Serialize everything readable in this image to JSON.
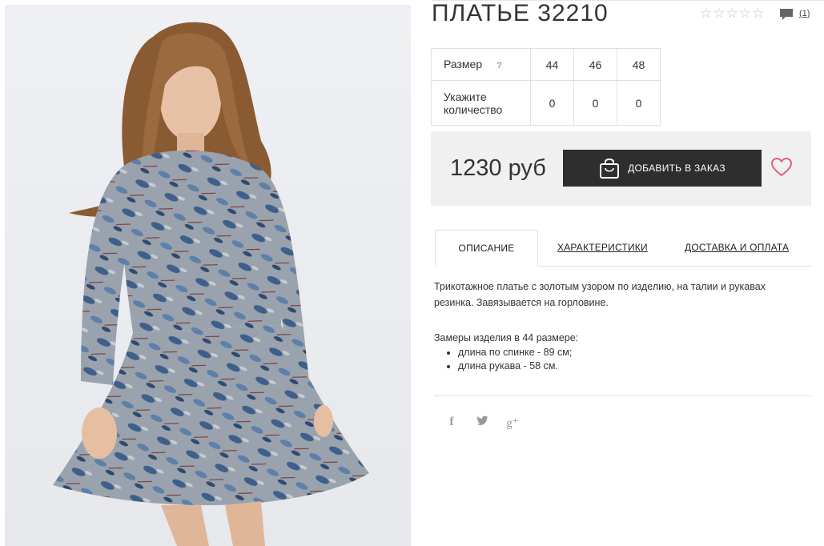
{
  "product": {
    "title": "ПЛАТЬЕ 32210",
    "review_count": "(1)",
    "rating_stars": [
      "☆",
      "☆",
      "☆",
      "☆",
      "☆"
    ],
    "rating_value": 0
  },
  "size_table": {
    "size_label": "Размер",
    "help_symbol": "?",
    "sizes": [
      "44",
      "46",
      "48"
    ],
    "quantity_label": "Укажите количество",
    "quantities": [
      "0",
      "0",
      "0"
    ]
  },
  "purchase": {
    "price": "1230 руб",
    "add_button_label": "ДОБАВИТЬ В ЗАКАЗ"
  },
  "tabs": [
    {
      "label": "ОПИСАНИЕ",
      "active": true
    },
    {
      "label": "ХАРАКТЕРИСТИКИ",
      "active": false
    },
    {
      "label": "ДОСТАВКА И ОПЛАТА",
      "active": false
    }
  ],
  "description": {
    "text": "Трикотажное платье с золотым узором по изделию, на талии и рукавах резинка. Завязывается на горловине.",
    "measurements_title": "Замеры изделия в 44 размере:",
    "measurements": [
      "длина по спинке - 89 см;",
      "длина рукава - 58 см."
    ]
  },
  "social": {
    "facebook": "f",
    "twitter": "🐦",
    "google_plus": "g⁺"
  },
  "colors": {
    "button_bg": "#2e2e2e",
    "panel_bg": "#f0f0f0",
    "heart": "#e0607a",
    "star": "#c9c9c9"
  }
}
